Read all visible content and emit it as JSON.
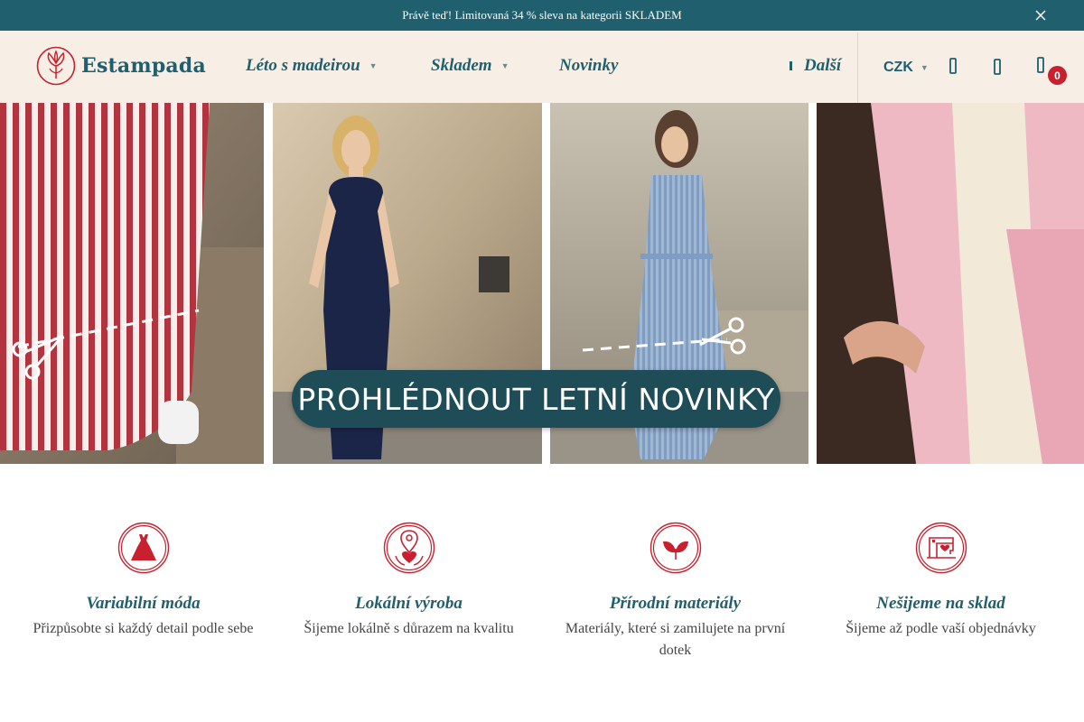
{
  "promo": {
    "text": "Právě teď! Limitovaná 34 % sleva na kategorii SKLADEM",
    "close_icon": "close-icon"
  },
  "header": {
    "logo_text": "Estampada",
    "nav": [
      {
        "label": "Léto s madeirou",
        "has_dropdown": true
      },
      {
        "label": "Skladem",
        "has_dropdown": true
      },
      {
        "label": "Novinky",
        "has_dropdown": false
      }
    ],
    "more_label": "Další",
    "currency": "CZK",
    "icons": [
      "search-icon",
      "user-icon",
      "cart-icon"
    ],
    "cart_count": "0"
  },
  "hero": {
    "cta_label": "PROHLÉDNOUT LETNÍ NOVINKY",
    "panels": [
      "red-white-striped-skirt",
      "navy-sleeveless-dress",
      "blue-striped-wrap-dress",
      "pink-jacket"
    ]
  },
  "features": [
    {
      "icon": "dress-icon",
      "title": "Variabilní móda",
      "text": "Přizpůsobte si každý detail podle sebe"
    },
    {
      "icon": "location-heart-icon",
      "title": "Lokální výroba",
      "text": "Šijeme lokálně s důrazem na kvalitu"
    },
    {
      "icon": "leaf-icon",
      "title": "Přírodní materiály",
      "text": "Materiály, které si zamilujete na první dotek"
    },
    {
      "icon": "sewing-machine-icon",
      "title": "Nešijeme na sklad",
      "text": "Šijeme až podle vaší objednávky"
    }
  ],
  "colors": {
    "brand_teal": "#1f5f6e",
    "accent_red": "#c8202e",
    "header_bg": "#f7efe6",
    "hero_button": "#1e4d57"
  }
}
